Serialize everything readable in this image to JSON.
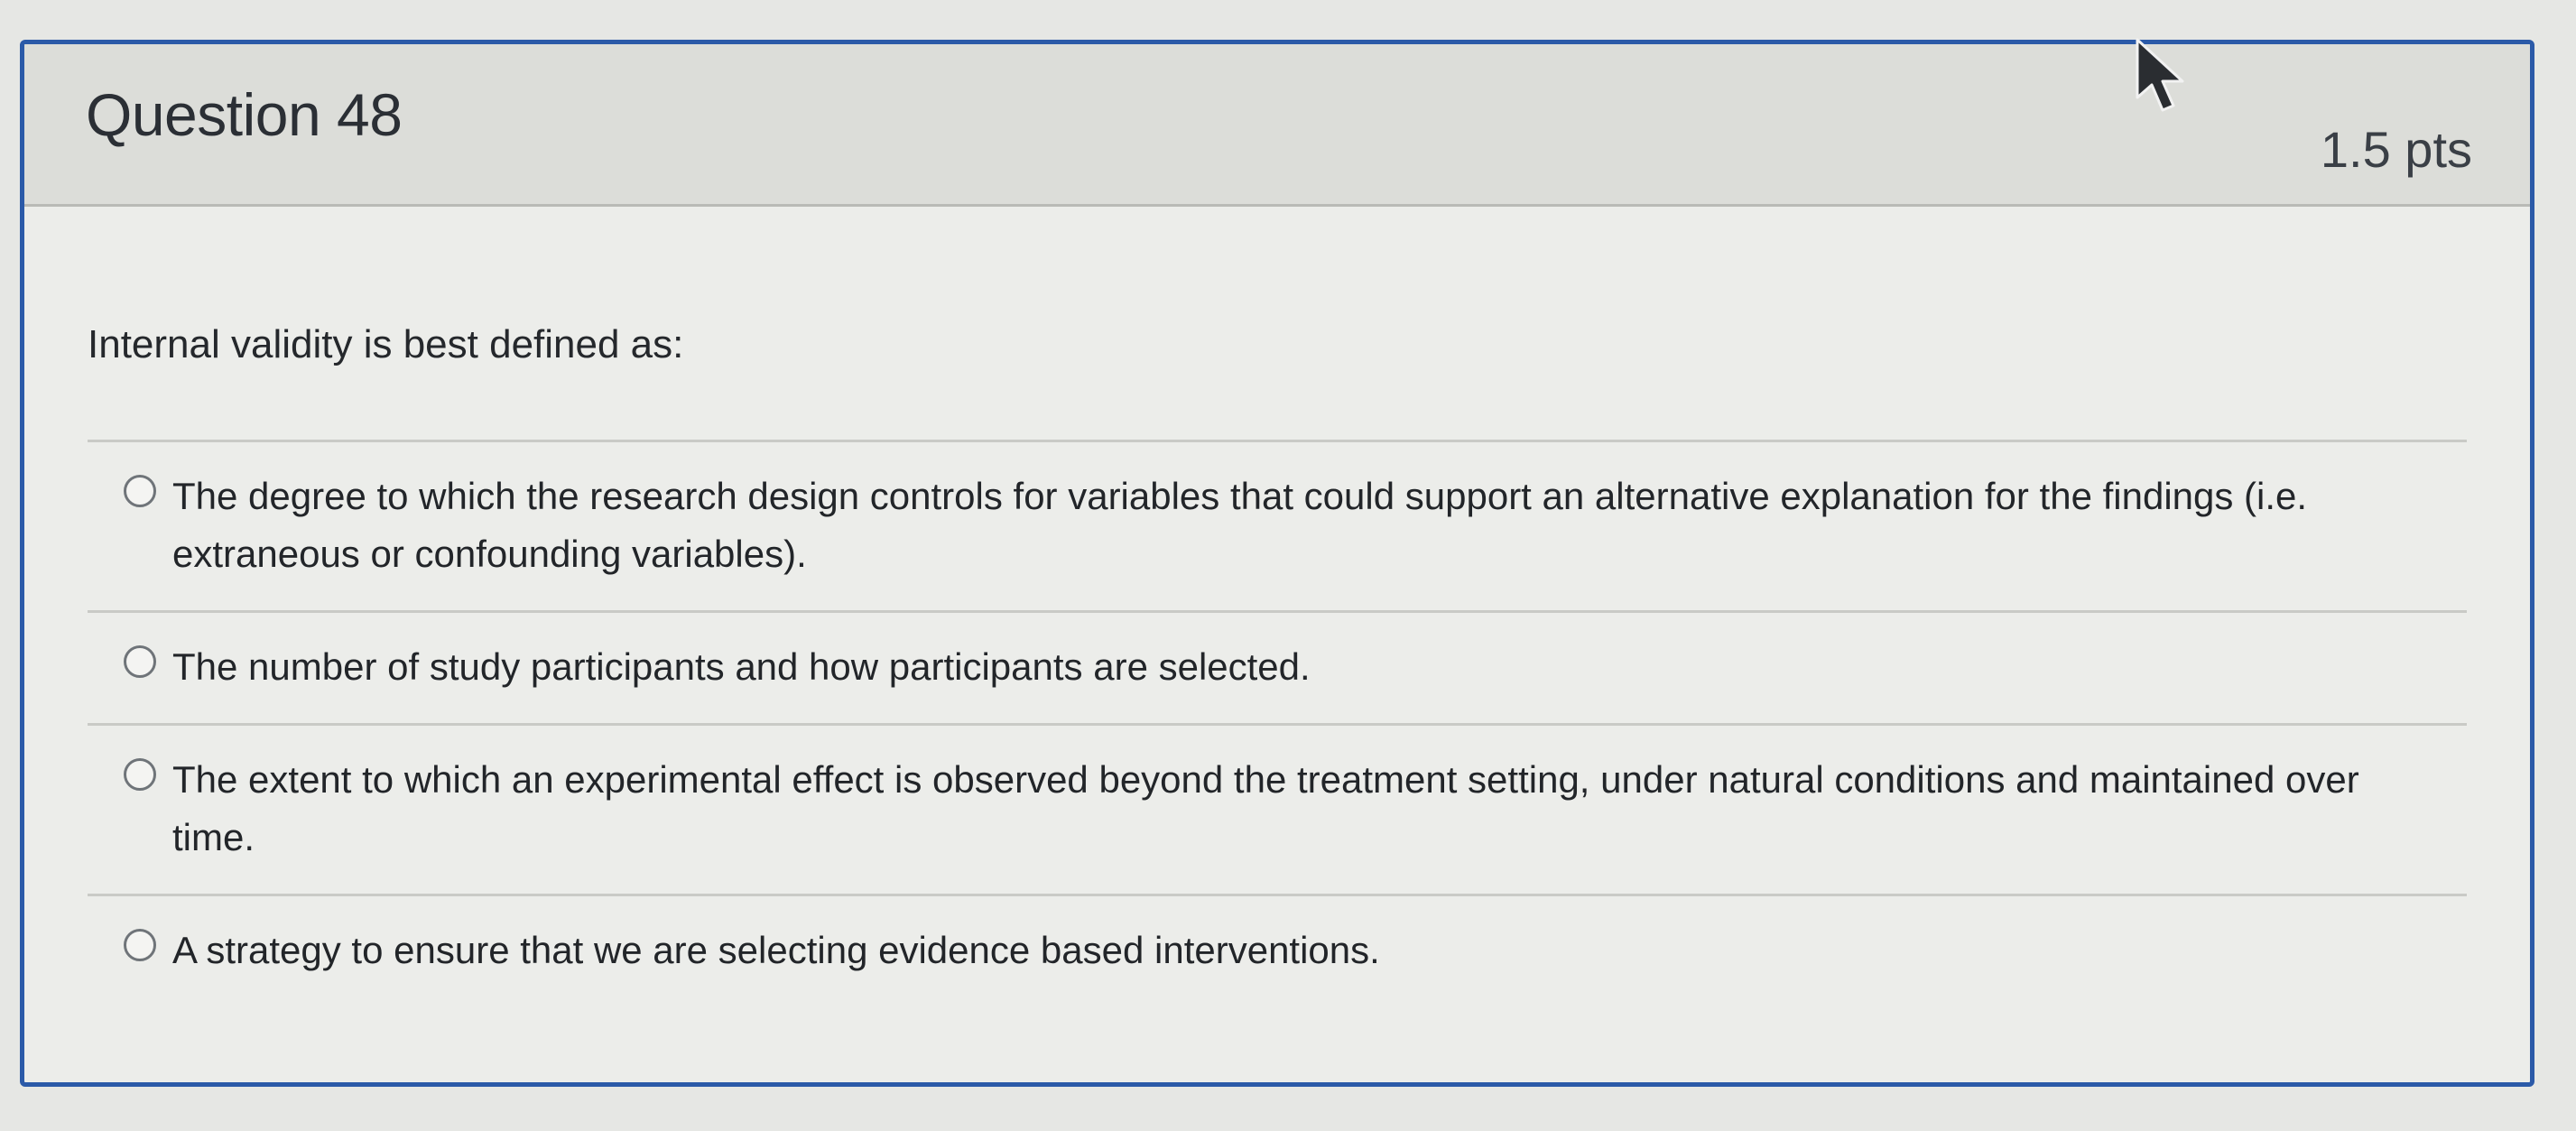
{
  "question": {
    "title": "Question 48",
    "points": "1.5 pts",
    "prompt": "Internal validity is best defined as:",
    "answers": [
      {
        "label": "The degree to which the research design controls for variables that could support an alternative explanation for the findings (i.e. extraneous or confounding variables)."
      },
      {
        "label": "The number of study participants and how participants are selected."
      },
      {
        "label": "The extent to which an experimental effect is observed beyond the treatment setting, under natural conditions and maintained over time."
      },
      {
        "label": "A strategy to ensure that we are selecting evidence based interventions."
      }
    ]
  },
  "colors": {
    "accent_border": "#2b5aa8",
    "header_background": "#dcddd9",
    "card_background": "#ecedea"
  }
}
